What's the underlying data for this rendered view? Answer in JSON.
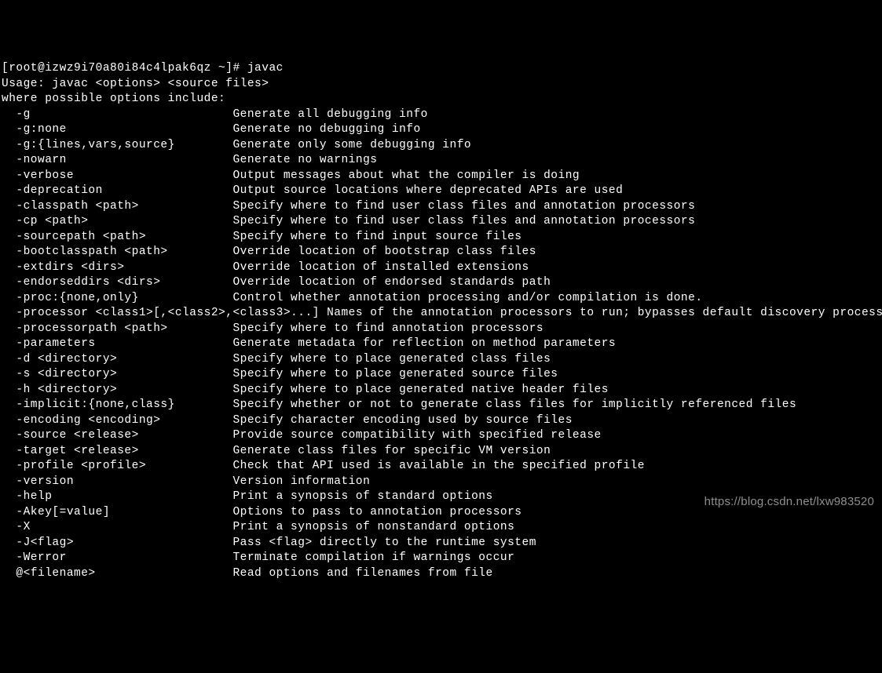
{
  "terminal": {
    "truncated_top": "                                                                                                       ",
    "prompt_line": "[root@izwz9i70a80i84c4lpak6qz ~]# javac",
    "usage_line": "Usage: javac <options> <source files>",
    "where_line": "where possible options include:",
    "options": [
      {
        "flag": "-g",
        "desc": "Generate all debugging info"
      },
      {
        "flag": "-g:none",
        "desc": "Generate no debugging info"
      },
      {
        "flag": "-g:{lines,vars,source}",
        "desc": "Generate only some debugging info"
      },
      {
        "flag": "-nowarn",
        "desc": "Generate no warnings"
      },
      {
        "flag": "-verbose",
        "desc": "Output messages about what the compiler is doing"
      },
      {
        "flag": "-deprecation",
        "desc": "Output source locations where deprecated APIs are used"
      },
      {
        "flag": "-classpath <path>",
        "desc": "Specify where to find user class files and annotation processors"
      },
      {
        "flag": "-cp <path>",
        "desc": "Specify where to find user class files and annotation processors"
      },
      {
        "flag": "-sourcepath <path>",
        "desc": "Specify where to find input source files"
      },
      {
        "flag": "-bootclasspath <path>",
        "desc": "Override location of bootstrap class files"
      },
      {
        "flag": "-extdirs <dirs>",
        "desc": "Override location of installed extensions"
      },
      {
        "flag": "-endorseddirs <dirs>",
        "desc": "Override location of endorsed standards path"
      },
      {
        "flag": "-proc:{none,only}",
        "desc": "Control whether annotation processing and/or compilation is done."
      },
      {
        "flag": "-processor <class1>[,<class2>,<class3>...] Names of the annotation processors to run; bypasses default discovery process",
        "desc": ""
      },
      {
        "flag": "-processorpath <path>",
        "desc": "Specify where to find annotation processors"
      },
      {
        "flag": "-parameters",
        "desc": "Generate metadata for reflection on method parameters"
      },
      {
        "flag": "-d <directory>",
        "desc": "Specify where to place generated class files"
      },
      {
        "flag": "-s <directory>",
        "desc": "Specify where to place generated source files"
      },
      {
        "flag": "-h <directory>",
        "desc": "Specify where to place generated native header files"
      },
      {
        "flag": "-implicit:{none,class}",
        "desc": "Specify whether or not to generate class files for implicitly referenced files"
      },
      {
        "flag": "-encoding <encoding>",
        "desc": "Specify character encoding used by source files"
      },
      {
        "flag": "-source <release>",
        "desc": "Provide source compatibility with specified release"
      },
      {
        "flag": "-target <release>",
        "desc": "Generate class files for specific VM version"
      },
      {
        "flag": "-profile <profile>",
        "desc": "Check that API used is available in the specified profile"
      },
      {
        "flag": "-version",
        "desc": "Version information"
      },
      {
        "flag": "-help",
        "desc": "Print a synopsis of standard options"
      },
      {
        "flag": "-Akey[=value]",
        "desc": "Options to pass to annotation processors"
      },
      {
        "flag": "-X",
        "desc": "Print a synopsis of nonstandard options"
      },
      {
        "flag": "-J<flag>",
        "desc": "Pass <flag> directly to the runtime system"
      },
      {
        "flag": "-Werror",
        "desc": "Terminate compilation if warnings occur"
      },
      {
        "flag": "@<filename>",
        "desc": "Read options and filenames from file"
      }
    ]
  },
  "watermark": "https://blog.csdn.net/lxw983520",
  "layout": {
    "flag_col_width": 30,
    "indent": "  "
  }
}
